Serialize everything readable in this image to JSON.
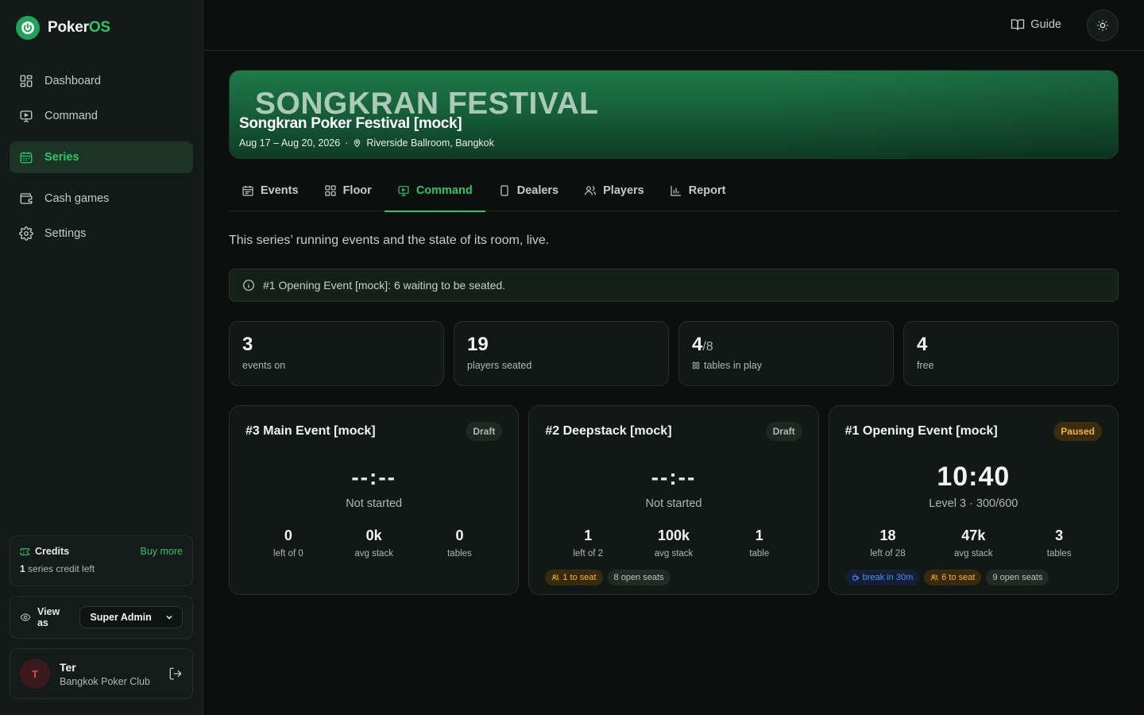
{
  "brand": {
    "name_main": "Poker",
    "name_accent": "OS"
  },
  "sidebar": {
    "items": [
      {
        "label": "Dashboard",
        "icon": "dashboard-icon"
      },
      {
        "label": "Command",
        "icon": "monitor-icon"
      },
      {
        "label": "Series",
        "icon": "calendar-icon",
        "active": true
      },
      {
        "label": "Cash games",
        "icon": "wallet-icon"
      },
      {
        "label": "Settings",
        "icon": "gear-icon"
      }
    ],
    "credits": {
      "title": "Credits",
      "buy": "Buy more",
      "count": "1",
      "text": "series credit left"
    },
    "view_as": {
      "label": "View as",
      "value": "Super Admin"
    },
    "user": {
      "initial": "T",
      "name": "Ter",
      "club": "Bangkok Poker Club"
    }
  },
  "header": {
    "guide": "Guide"
  },
  "banner": {
    "big": "SONGKRAN FESTIVAL",
    "title": "Songkran Poker Festival [mock]",
    "dates": "Aug 17 – Aug 20, 2026",
    "sep": "·",
    "venue": "Riverside Ballroom, Bangkok"
  },
  "tabs": [
    {
      "label": "Events"
    },
    {
      "label": "Floor"
    },
    {
      "label": "Command",
      "active": true
    },
    {
      "label": "Dealers"
    },
    {
      "label": "Players"
    },
    {
      "label": "Report"
    }
  ],
  "description": "This series’ running events and the state of its room, live.",
  "alert": "#1 Opening Event [mock]: 6 waiting to be seated.",
  "stats": [
    {
      "value": "3",
      "label": "events on"
    },
    {
      "value": "19",
      "label": "players seated"
    },
    {
      "value": "4",
      "denominator": "/8",
      "label": "tables in play"
    },
    {
      "value": "4",
      "label": "free"
    }
  ],
  "events": [
    {
      "name": "#3 Main Event [mock]",
      "badge": "Draft",
      "clock": "--:--",
      "status": "Not started",
      "metrics": [
        {
          "value": "0",
          "label": "left of 0"
        },
        {
          "value": "0k",
          "label": "avg stack"
        },
        {
          "value": "0",
          "label": "tables"
        }
      ]
    },
    {
      "name": "#2 Deepstack [mock]",
      "badge": "Draft",
      "clock": "--:--",
      "status": "Not started",
      "metrics": [
        {
          "value": "1",
          "label": "left of 2"
        },
        {
          "value": "100k",
          "label": "avg stack"
        },
        {
          "value": "1",
          "label": "table"
        }
      ],
      "chips": {
        "seat": "1 to seat",
        "open": "8 open seats"
      }
    },
    {
      "name": "#1 Opening Event [mock]",
      "badge": "Paused",
      "clock": "10:40",
      "status": "Level 3 · 300/600",
      "metrics": [
        {
          "value": "18",
          "label": "left of 28"
        },
        {
          "value": "47k",
          "label": "avg stack"
        },
        {
          "value": "3",
          "label": "tables"
        }
      ],
      "chips": {
        "break": "break in 30m",
        "seat": "6 to seat",
        "open": "9 open seats"
      }
    }
  ],
  "colors": {
    "accent": "#2fc36b",
    "warning": "#f3b233",
    "info": "#4f8df5",
    "background": "#0c0f0d"
  }
}
